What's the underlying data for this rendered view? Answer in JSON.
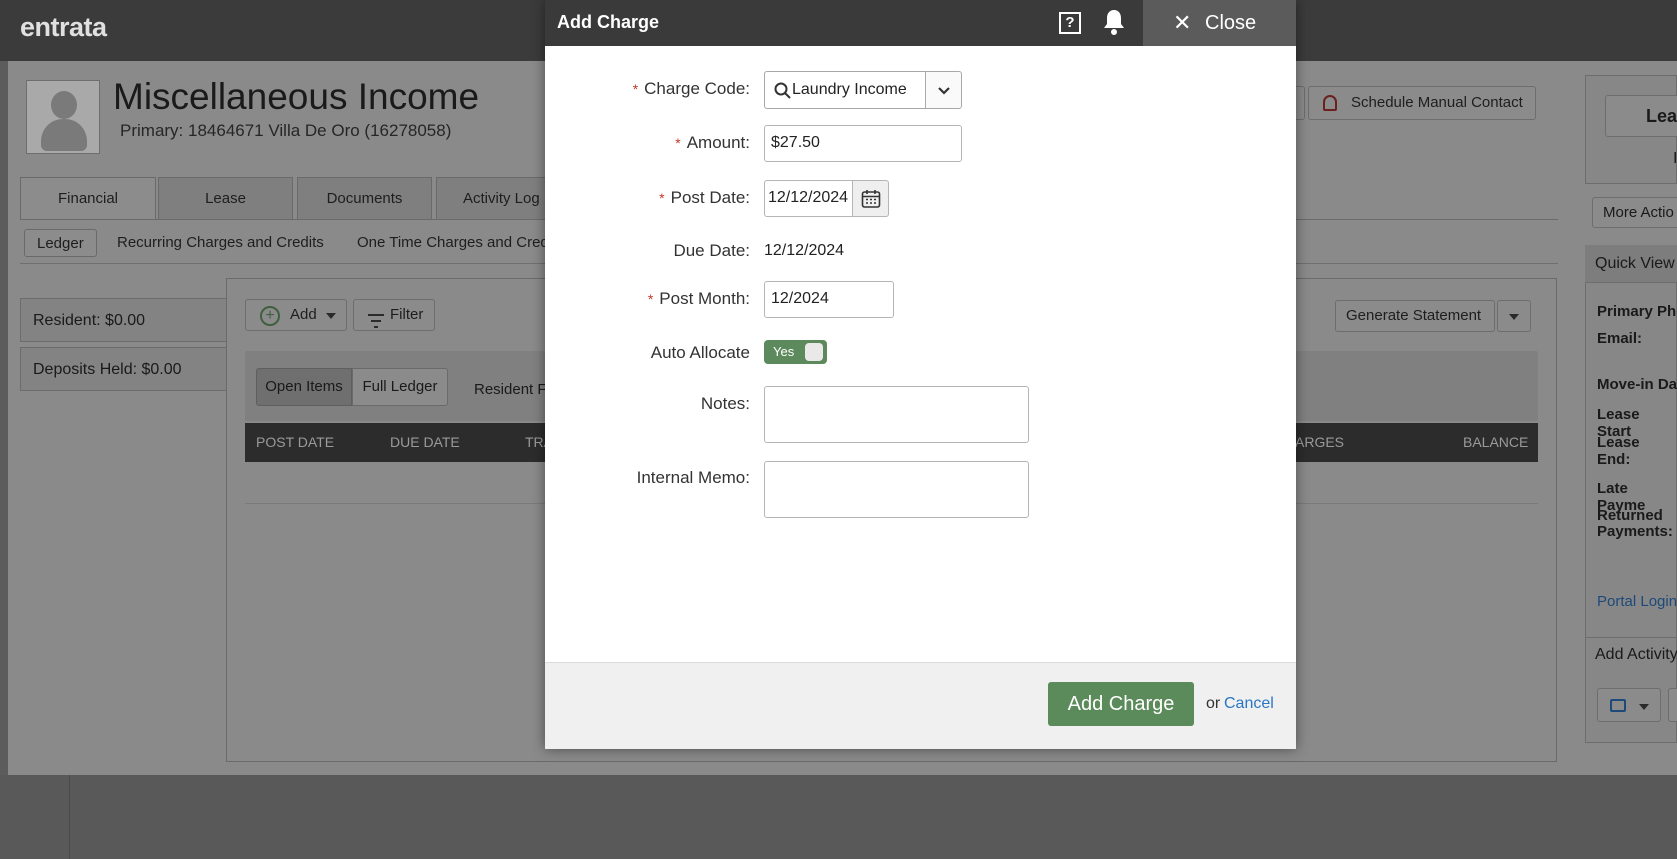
{
  "app": {
    "logo": "entrata"
  },
  "background": {
    "resident_name": "Miscellaneous Income",
    "primary_line": "Primary: 18464671 Villa De Oro (16278058)",
    "tabs": [
      "Financial",
      "Lease",
      "Documents",
      "Activity Log"
    ],
    "subtabs": [
      "Ledger",
      "Recurring Charges and Credits",
      "One Time Charges and Cred"
    ],
    "resident_balance": "Resident: $0.00",
    "deposits_held": "Deposits Held: $0.00",
    "add_label": "Add",
    "filter_label": "Filter",
    "open_items_label": "Open Items",
    "full_ledger_label": "Full Ledger",
    "resident_filter_label": "Resident F",
    "generate_statement_label": "Generate Statement",
    "schedule_contact_label": "Schedule Manual Contact",
    "table_headers": {
      "post_date": "POST DATE",
      "due_date": "DUE DATE",
      "tra": "TRA",
      "charges": "ARGES",
      "balance": "BALANCE"
    },
    "right_panel": {
      "lease_label": "Lea",
      "lease_sub": "I",
      "more_actions": "More Actio",
      "quick_view": "Quick View",
      "primary_phone": "Primary Ph",
      "email": "Email:",
      "move_in": "Move-in Da",
      "lease_start": "Lease Start",
      "lease_end": "Lease End:",
      "late_payments": "Late Payme",
      "returned_payments_1": "Returned",
      "returned_payments_2": "Payments:",
      "portal_login": "Portal Login",
      "add_activity": "Add Activity"
    }
  },
  "modal": {
    "title": "Add Charge",
    "help_icon_label": "?",
    "close_label": "Close",
    "close_glyph": "✕",
    "fields": {
      "charge_code": {
        "label": "Charge Code:",
        "value": "Laundry Income",
        "required": true
      },
      "amount": {
        "label": "Amount:",
        "value": "$27.50",
        "required": true
      },
      "post_date": {
        "label": "Post Date:",
        "value": "12/12/2024",
        "required": true
      },
      "due_date": {
        "label": "Due Date:",
        "value": "12/12/2024",
        "required": false
      },
      "post_month": {
        "label": "Post Month:",
        "value": "12/2024",
        "required": true
      },
      "auto_allocate": {
        "label": "Auto Allocate",
        "value": "Yes"
      },
      "notes": {
        "label": "Notes:",
        "value": ""
      },
      "internal_memo": {
        "label": "Internal Memo:",
        "value": ""
      }
    },
    "required_marker": "*",
    "submit_label": "Add Charge",
    "or_text": "or",
    "cancel_label": "Cancel"
  },
  "colors": {
    "primary_green": "#5b8a5b",
    "link_blue": "#2b76c2",
    "required_red": "#c0392b",
    "header_dark": "#3a3a3a"
  },
  "icons": {
    "search": "search-icon",
    "chevron": "chevron-down-icon",
    "calendar": "calendar-icon",
    "help": "help-icon",
    "bell": "bell-icon",
    "close": "close-icon",
    "avatar": "avatar-icon",
    "add": "plus-circle-icon",
    "filter": "filter-icon"
  }
}
